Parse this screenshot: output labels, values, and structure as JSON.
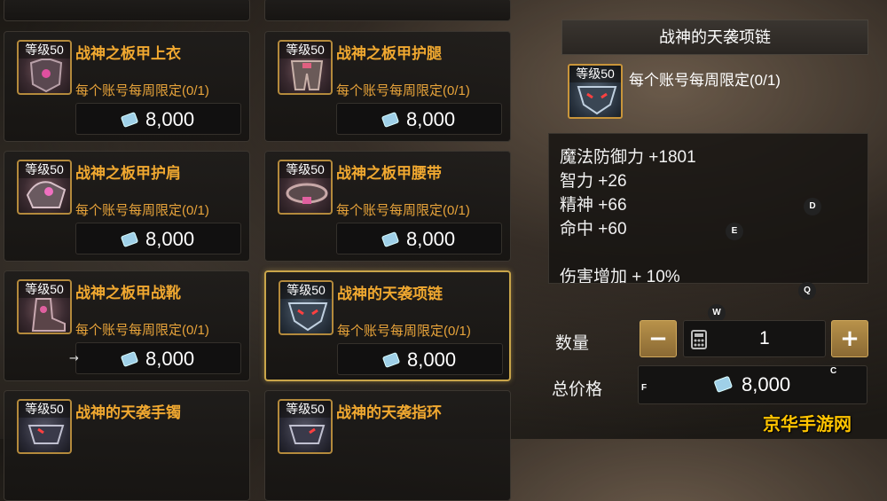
{
  "shop": {
    "items": [
      {
        "level": "等级50",
        "name": "战神之板甲上衣",
        "limit": "每个账号每周限定(0/1)",
        "price": "8,000"
      },
      {
        "level": "等级50",
        "name": "战神之板甲护腿",
        "limit": "每个账号每周限定(0/1)",
        "price": "8,000"
      },
      {
        "level": "等级50",
        "name": "战神之板甲护肩",
        "limit": "每个账号每周限定(0/1)",
        "price": "8,000"
      },
      {
        "level": "等级50",
        "name": "战神之板甲腰带",
        "limit": "每个账号每周限定(0/1)",
        "price": "8,000"
      },
      {
        "level": "等级50",
        "name": "战神之板甲战靴",
        "limit": "每个账号每周限定(0/1)",
        "price": "8,000"
      },
      {
        "level": "等级50",
        "name": "战神的天袭项链",
        "limit": "每个账号每周限定(0/1)",
        "price": "8,000"
      },
      {
        "level": "等级50",
        "name": "战神的天袭手镯"
      },
      {
        "level": "等级50",
        "name": "战神的天袭指环"
      }
    ],
    "arrow_text": "→"
  },
  "detail": {
    "title": "战神的天袭项链",
    "level": "等级50",
    "limit": "每个账号每周限定(0/1)",
    "stats": [
      "魔法防御力 +1801",
      "智力 +26",
      "精神 +66",
      "命中 +60",
      "",
      "伤害增加 + 10%"
    ],
    "quantity_label": "数量",
    "minus": "−",
    "plus": "+",
    "quantity": "1",
    "total_label": "总价格",
    "total": "8,000"
  },
  "markers": {
    "d": "D",
    "e": "E",
    "q": "Q",
    "w": "W",
    "c": "C",
    "f": "F"
  },
  "watermark": "京华手游网",
  "colors": {
    "accent_gold": "#c9a54a",
    "item_name": "#f0a830",
    "limit_text": "#e7a33a"
  }
}
